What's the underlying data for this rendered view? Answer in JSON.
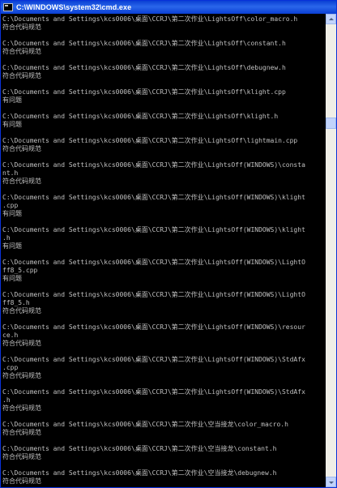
{
  "window": {
    "title": "C:\\WINDOWS\\system32\\cmd.exe",
    "icon": "cmd-console-icon"
  },
  "console": {
    "lines": [
      "C:\\Documents and Settings\\kcs0006\\桌面\\CCRJ\\第二次作业\\LightsOff\\color_macro.h",
      "符合代码规范",
      "",
      "C:\\Documents and Settings\\kcs0006\\桌面\\CCRJ\\第二次作业\\LightsOff\\constant.h",
      "符合代码规范",
      "",
      "C:\\Documents and Settings\\kcs0006\\桌面\\CCRJ\\第二次作业\\LightsOff\\debugnew.h",
      "符合代码规范",
      "",
      "C:\\Documents and Settings\\kcs0006\\桌面\\CCRJ\\第二次作业\\LightsOff\\klight.cpp",
      "有问题",
      "",
      "C:\\Documents and Settings\\kcs0006\\桌面\\CCRJ\\第二次作业\\LightsOff\\klight.h",
      "有问题",
      "",
      "C:\\Documents and Settings\\kcs0006\\桌面\\CCRJ\\第二次作业\\LightsOff\\lightmain.cpp",
      "符合代码规范",
      "",
      "C:\\Documents and Settings\\kcs0006\\桌面\\CCRJ\\第二次作业\\LightsOff(WINDOWS)\\consta",
      "nt.h",
      "符合代码规范",
      "",
      "C:\\Documents and Settings\\kcs0006\\桌面\\CCRJ\\第二次作业\\LightsOff(WINDOWS)\\klight",
      ".cpp",
      "有问题",
      "",
      "C:\\Documents and Settings\\kcs0006\\桌面\\CCRJ\\第二次作业\\LightsOff(WINDOWS)\\klight",
      ".h",
      "有问题",
      "",
      "C:\\Documents and Settings\\kcs0006\\桌面\\CCRJ\\第二次作业\\LightsOff(WINDOWS)\\LightO",
      "ff8_5.cpp",
      "有问题",
      "",
      "C:\\Documents and Settings\\kcs0006\\桌面\\CCRJ\\第二次作业\\LightsOff(WINDOWS)\\LightO",
      "ff8_5.h",
      "符合代码规范",
      "",
      "C:\\Documents and Settings\\kcs0006\\桌面\\CCRJ\\第二次作业\\LightsOff(WINDOWS)\\resour",
      "ce.h",
      "符合代码规范",
      "",
      "C:\\Documents and Settings\\kcs0006\\桌面\\CCRJ\\第二次作业\\LightsOff(WINDOWS)\\StdAfx",
      ".cpp",
      "符合代码规范",
      "",
      "C:\\Documents and Settings\\kcs0006\\桌面\\CCRJ\\第二次作业\\LightsOff(WINDOWS)\\StdAfx",
      ".h",
      "符合代码规范",
      "",
      "C:\\Documents and Settings\\kcs0006\\桌面\\CCRJ\\第二次作业\\空当接龙\\color_macro.h",
      "符合代码规范",
      "",
      "C:\\Documents and Settings\\kcs0006\\桌面\\CCRJ\\第二次作业\\空当接龙\\constant.h",
      "符合代码规范",
      "",
      "C:\\Documents and Settings\\kcs0006\\桌面\\CCRJ\\第二次作业\\空当接龙\\debugnew.h",
      "符合代码规范"
    ]
  },
  "colors": {
    "titlebar": "#0a3fd4",
    "console_bg": "#000000",
    "console_text": "#c0c0c0"
  }
}
